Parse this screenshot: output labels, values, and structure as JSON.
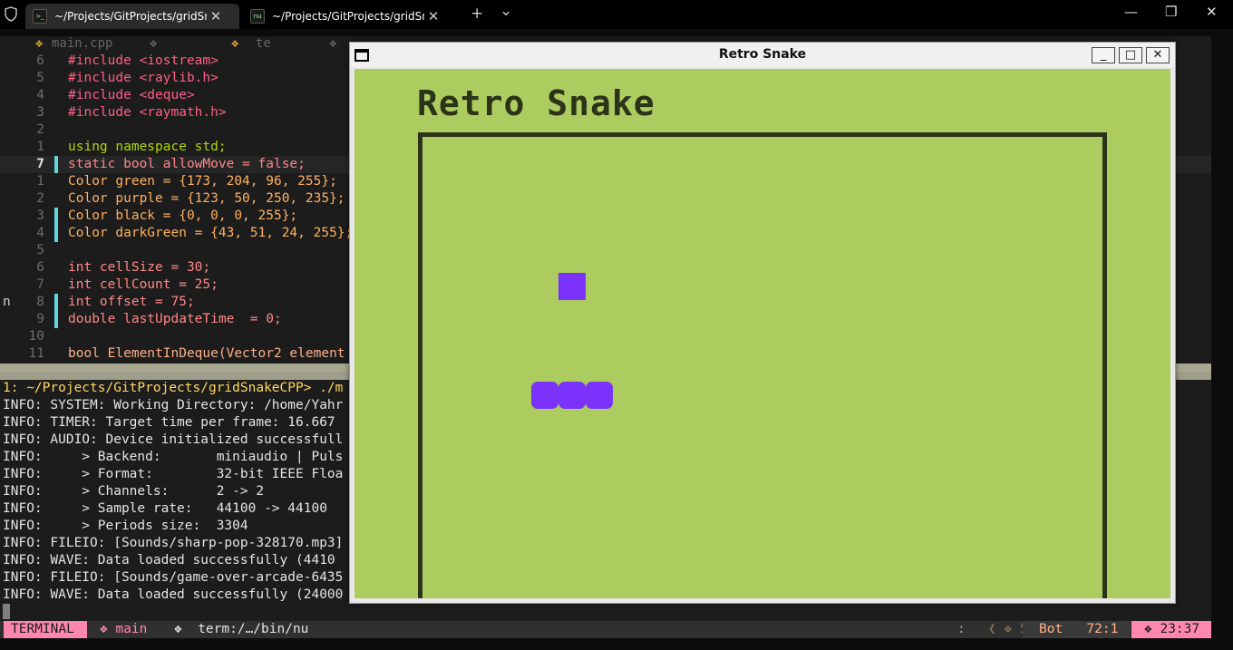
{
  "host": {
    "tabs": [
      {
        "title": "~/Projects/GitProjects/gridSnak",
        "icon": "terminal-icon",
        "active": true
      },
      {
        "title": "~/Projects/GitProjects/gridSnak",
        "icon": "nushell-icon",
        "active": false
      }
    ],
    "new_tab": "+",
    "dropdown": "⌄",
    "minimize": "—",
    "maximize": "❐",
    "close": "✕"
  },
  "editor": {
    "buffer_tabs": [
      {
        "marker": "❖",
        "label": "main.cpp"
      },
      {
        "marker": "",
        "label": "❖"
      },
      {
        "marker": "❖",
        "label": "te"
      },
      {
        "marker": "",
        "label": "❖"
      }
    ],
    "lines": [
      {
        "num": "6",
        "text": "#include <iostream>"
      },
      {
        "num": "5",
        "text": "#include <raylib.h>"
      },
      {
        "num": "4",
        "text": "#include <deque>"
      },
      {
        "num": "3",
        "text": "#include <raymath.h>"
      },
      {
        "num": "2",
        "text": ""
      },
      {
        "num": "1",
        "text": "using namespace std;"
      },
      {
        "num": "7",
        "text": "static bool allowMove = false;"
      },
      {
        "num": "1",
        "text": "Color green = {173, 204, 96, 255};"
      },
      {
        "num": "2",
        "text": "Color purple = {123, 50, 250, 235};"
      },
      {
        "num": "3",
        "text": "Color black = {0, 0, 0, 255};"
      },
      {
        "num": "4",
        "text": "Color darkGreen = {43, 51, 24, 255};"
      },
      {
        "num": "5",
        "text": ""
      },
      {
        "num": "6",
        "text": "int cellSize = 30;"
      },
      {
        "num": "7",
        "text": "int cellCount = 25;"
      },
      {
        "num": "8",
        "text": "int offset = 75;"
      },
      {
        "num": "9",
        "text": "double lastUpdateTime  = 0;"
      },
      {
        "num": "10",
        "text": ""
      },
      {
        "num": "11",
        "text": "bool ElementInDeque(Vector2 element"
      }
    ],
    "side_char": "n"
  },
  "terminal": {
    "prompt": "1: ~/Projects/GitProjects/gridSnakeCPP> ./m",
    "output": [
      "INFO: SYSTEM: Working Directory: /home/Yahr",
      "INFO: TIMER: Target time per frame: 16.667",
      "INFO: AUDIO: Device initialized successfull",
      "INFO:     > Backend:       miniaudio | Puls",
      "INFO:     > Format:        32-bit IEEE Floa",
      "INFO:     > Channels:      2 -> 2",
      "INFO:     > Sample rate:   44100 -> 44100",
      "INFO:     > Periods size:  3304",
      "INFO: FILEIO: [Sounds/sharp-pop-328170.mp3]",
      "INFO: WAVE: Data loaded successfully (4410",
      "INFO: FILEIO: [Sounds/game-over-arcade-6435",
      "INFO: WAVE: Data loaded successfully (24000"
    ]
  },
  "statusline": {
    "mode": "TERMINAL",
    "branch": "❖ main",
    "file": "❖  term:/…/bin/nu",
    "right_sep": ":",
    "diag": "❮ ❖ 5",
    "position": "Bot   72:1",
    "time": "❖ 23:37"
  },
  "game": {
    "window_title": "Retro Snake",
    "heading": "Retro Snake",
    "buttons": {
      "minimize": "_",
      "maximize": "□",
      "close": "✕"
    },
    "colors": {
      "background": "#adcc60",
      "food": "#7b32fa",
      "snake": "#7b32fa",
      "border": "#2b3318"
    },
    "food_cell": {
      "col": 5,
      "row": 5
    },
    "snake_cells": [
      {
        "col": 4,
        "row": 9
      },
      {
        "col": 5,
        "row": 9
      },
      {
        "col": 6,
        "row": 9
      }
    ]
  }
}
